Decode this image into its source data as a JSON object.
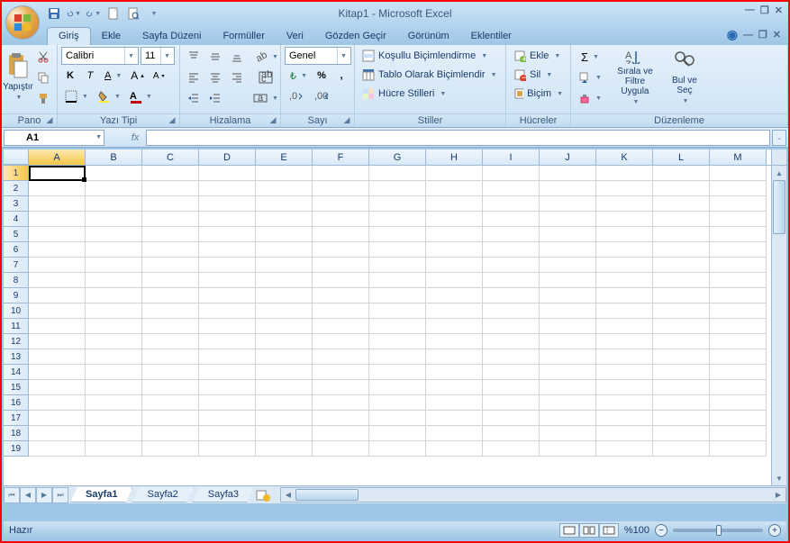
{
  "title": "Kitap1 - Microsoft Excel",
  "qat": {
    "save": "save-icon",
    "undo": "undo-icon",
    "redo": "redo-icon",
    "new": "new-doc-icon",
    "print": "print-preview-icon"
  },
  "tabs": {
    "items": [
      {
        "label": "Giriş",
        "active": true
      },
      {
        "label": "Ekle"
      },
      {
        "label": "Sayfa Düzeni"
      },
      {
        "label": "Formüller"
      },
      {
        "label": "Veri"
      },
      {
        "label": "Gözden Geçir"
      },
      {
        "label": "Görünüm"
      },
      {
        "label": "Eklentiler"
      }
    ]
  },
  "ribbon": {
    "clipboard": {
      "label": "Pano",
      "paste": "Yapıştır"
    },
    "font": {
      "label": "Yazı Tipi",
      "family": "Calibri",
      "size": "11"
    },
    "alignment": {
      "label": "Hizalama"
    },
    "number": {
      "label": "Sayı",
      "format": "Genel"
    },
    "styles": {
      "label": "Stiller",
      "cond": "Koşullu Biçimlendirme",
      "table": "Tablo Olarak Biçimlendir",
      "cell": "Hücre Stilleri"
    },
    "cells": {
      "label": "Hücreler",
      "insert": "Ekle",
      "delete": "Sil",
      "format": "Biçim"
    },
    "editing": {
      "label": "Düzenleme",
      "sort": "Sırala ve Filtre Uygula",
      "find": "Bul ve Seç"
    }
  },
  "namebox": "A1",
  "columns": [
    "A",
    "B",
    "C",
    "D",
    "E",
    "F",
    "G",
    "H",
    "I",
    "J",
    "K",
    "L",
    "M"
  ],
  "rows": [
    1,
    2,
    3,
    4,
    5,
    6,
    7,
    8,
    9,
    10,
    11,
    12,
    13,
    14,
    15,
    16,
    17,
    18,
    19
  ],
  "active": {
    "col": "A",
    "row": 1
  },
  "sheets": {
    "items": [
      {
        "label": "Sayfa1",
        "active": true
      },
      {
        "label": "Sayfa2"
      },
      {
        "label": "Sayfa3"
      }
    ]
  },
  "status": {
    "ready": "Hazır",
    "zoom": "%100"
  }
}
